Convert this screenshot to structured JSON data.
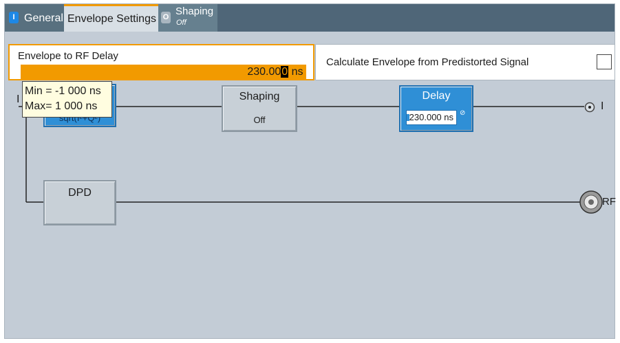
{
  "tabs": {
    "general": {
      "indicator": "I",
      "label": "General"
    },
    "envelope": {
      "label": "Envelope Settings"
    },
    "shaping": {
      "indicator": "O",
      "label": "Shaping",
      "sublabel": "Off"
    }
  },
  "envelope_delay": {
    "label": "Envelope to RF Delay",
    "value_before_cursor": "230.00",
    "value_cursor": "0",
    "unit": " ns"
  },
  "calc_envelope": {
    "label": "Calculate Envelope from Predistorted Signal",
    "checked": false
  },
  "tooltip": {
    "min": "Min = -1 000 ns",
    "max": "Max= 1 000 ns"
  },
  "diagram": {
    "input_label": "I",
    "sqrt_block": {
      "text": "sqrt(I²+Q²)"
    },
    "shaping_block": {
      "title": "Shaping",
      "state": "Off"
    },
    "delay_block": {
      "title": "Delay",
      "value": "230.000 ns"
    },
    "dpd_block": {
      "title": "DPD"
    },
    "output_i_label": "I",
    "output_rf_label": "RF"
  },
  "colors": {
    "accent": "#f29a00",
    "active_block": "#2f8fd6",
    "tab_bar": "#4f6678",
    "background": "#c3ccd6"
  }
}
